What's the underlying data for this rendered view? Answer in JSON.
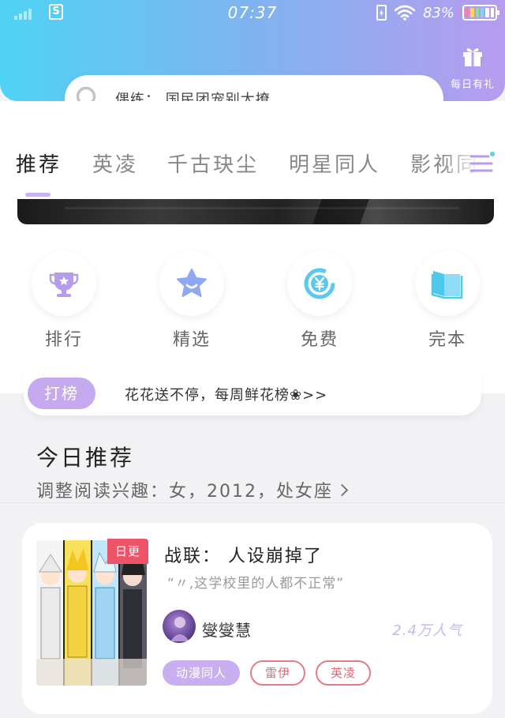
{
  "status_bar": {
    "time": "07:37",
    "sim_label": "S",
    "battery_percent": "83%"
  },
  "header": {
    "gift_label": "每日有礼",
    "search_text": "偶练： 国民团宠别太撩"
  },
  "tabs": [
    {
      "label": "推荐",
      "active": true
    },
    {
      "label": "英凌"
    },
    {
      "label": "千古玦尘"
    },
    {
      "label": "明星同人"
    },
    {
      "label": "影视同"
    }
  ],
  "quick_actions": [
    {
      "label": "排行",
      "icon": "trophy-icon"
    },
    {
      "label": "精选",
      "icon": "star-icon"
    },
    {
      "label": "免费",
      "icon": "yen-coin-icon"
    },
    {
      "label": "完本",
      "icon": "book-icon"
    }
  ],
  "daban": {
    "badge": "打榜",
    "text": "花花送不停，每周鲜花榜❀>>"
  },
  "today": {
    "title": "今日推荐",
    "subtitle": "调整阅读兴趣：女，2012，处女座"
  },
  "book": {
    "badge": "日更",
    "title": "战联： 人设崩掉了",
    "quote": "“〃,这学校里的人都不正常”",
    "author": "燮燮慧",
    "popularity": "2.4万人气",
    "tags": [
      "动漫同人",
      "雷伊",
      "英凌"
    ]
  },
  "colors": {
    "header_gradient_start": "#4fd3f5",
    "header_gradient_end": "#b79cee",
    "accent_purple": "#c6aaf0",
    "badge_red": "#ee5468",
    "tag_outline_red": "#e67a86"
  }
}
